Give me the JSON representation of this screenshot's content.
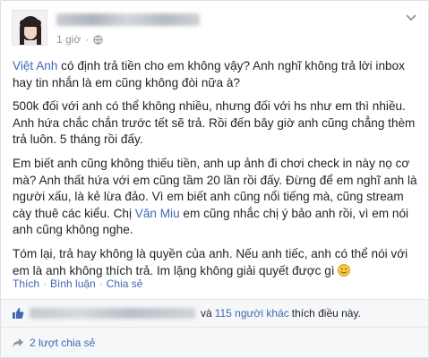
{
  "post": {
    "time": "1 giờ",
    "paragraphs": [
      {
        "lead_link": "Việt Anh",
        "text": " có định trả tiền cho em không vậy? Anh nghĩ không trả lời inbox\nhay tin nhắn là em cũng không đòi nữa à?"
      },
      {
        "text": "500k đối với anh có thể không nhiều, nhưng đối với hs như em thì nhiều.\nAnh hứa chắc chắn trước tết sẽ trả. Rồi đến bây giờ anh cũng chẳng thèm\ntrả luôn. 5 tháng rồi đấy."
      },
      {
        "text_before": "Em biết anh cũng không thiếu tiền, anh up ảnh đi chơi check in này nọ cơ\nmà? Anh thất hứa với em cũng tầm 20 lần rồi đấy. Đừng để em nghĩ anh là\nngười xấu, là kẻ lừa đảo. Vì em biết anh cũng nổi tiếng mà, cũng stream\ncày thuê các kiểu. Chị ",
        "mid_link": "Vân Miu",
        "text_after": " em cũng nhắc chị ý bảo anh rồi, vì em nói\nanh cũng không nghe."
      },
      {
        "text": "Tóm lại, trả hay không là quyền của anh. Nếu anh tiếc, anh có thể nói với\nem là anh không thích trả. Im lặng không giải quyết được gì "
      }
    ]
  },
  "actions": {
    "like": "Thích",
    "comment": "Bình luận",
    "share": "Chia sẻ",
    "separator": "·"
  },
  "likes": {
    "conjunction": "và",
    "others_link": "115 người khác",
    "suffix": "thích điều này."
  },
  "shares": {
    "label": "2 lượt chia sẻ"
  },
  "colors": {
    "link": "#4267b2",
    "muted": "#90949c"
  }
}
